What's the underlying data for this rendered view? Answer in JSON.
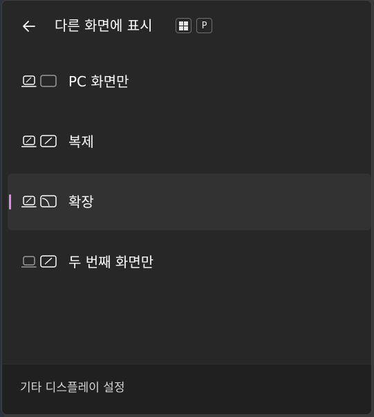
{
  "header": {
    "title": "다른 화면에 표시",
    "shortcut_key": "P"
  },
  "options": [
    {
      "label": "PC 화면만",
      "selected": false
    },
    {
      "label": "복제",
      "selected": false
    },
    {
      "label": "확장",
      "selected": true
    },
    {
      "label": "두 번째 화면만",
      "selected": false
    }
  ],
  "footer": {
    "link_label": "기타 디스플레이 설정"
  },
  "colors": {
    "panel_bg": "#272727",
    "selected_bg": "#323232",
    "accent_indicator": "#e28ce8",
    "text": "#ffffff",
    "footer_bg": "#202020"
  }
}
